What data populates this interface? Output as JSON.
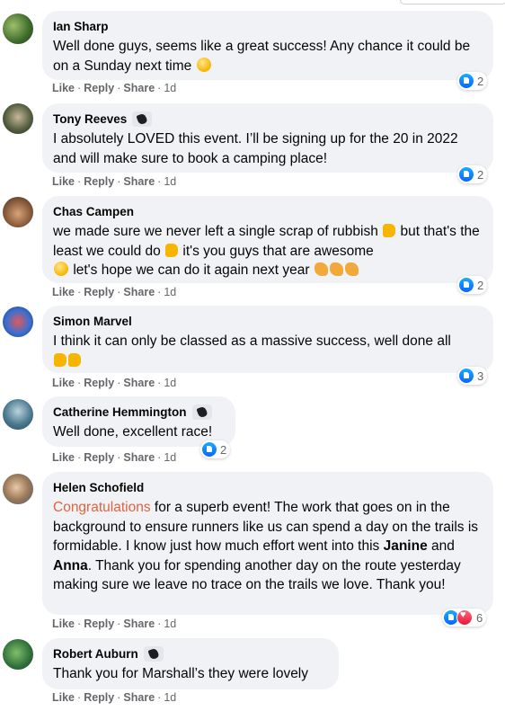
{
  "actions": {
    "like": "Like",
    "reply": "Reply",
    "share": "Share",
    "separator": "·"
  },
  "comments": [
    {
      "author": "Ian Sharp",
      "fan_badge": false,
      "text": "Well done guys, seems like a great success! Any chance it could be on a Sunday next time",
      "time": "1d",
      "reaction_count": "2"
    },
    {
      "author": "Tony Reeves",
      "fan_badge": true,
      "text": "I absolutely LOVED this event. I’ll be signing up for the 20 in 2022 and will make sure to book a camping place!",
      "time": "1d",
      "reaction_count": "2"
    },
    {
      "author": "Chas Campen",
      "fan_badge": false,
      "text_a": "we made sure we never left a single scrap of rubbish",
      "text_b": "but that's the least we could do",
      "text_c": "it's you guys that are awesome",
      "text_d": "let's hope we can do it again next year",
      "time": "1d",
      "reaction_count": "2"
    },
    {
      "author": "Simon Marvel",
      "fan_badge": false,
      "text": "I think it can only be classed as a massive success, well done all",
      "time": "1d",
      "reaction_count": "3"
    },
    {
      "author": "Catherine Hemmington",
      "fan_badge": true,
      "text": "Well done, excellent race!",
      "time": "1d",
      "reaction_count": "2"
    },
    {
      "author": "Helen Schofield",
      "fan_badge": false,
      "highlight": "Congratulations",
      "text_a": "for a superb event! The work that goes on in the background to ensure runners like us can spend a day on the trails is formidable. I know just how much effort went into this",
      "name_1": "Janine",
      "and": "and",
      "name_2": "Anna",
      "text_b": ". Thank you for spending another day on the route yesterday making sure we leave no trace on the trails we love. Thank you!",
      "time": "1d",
      "reaction_count": "6"
    },
    {
      "author": "Robert Auburn",
      "fan_badge": true,
      "text": "Thank you for Marshall’s they were lovely",
      "time": "1d",
      "reaction_count": ""
    }
  ],
  "icons": {
    "like": "like-reaction-icon",
    "love": "love-reaction-icon",
    "fan": "top-fan-badge-icon"
  },
  "colors": {
    "bubble": "#f0f2f5",
    "meta": "#65676b",
    "highlight": "#e1623f",
    "like": "#0866ff",
    "love": "#e61739"
  }
}
